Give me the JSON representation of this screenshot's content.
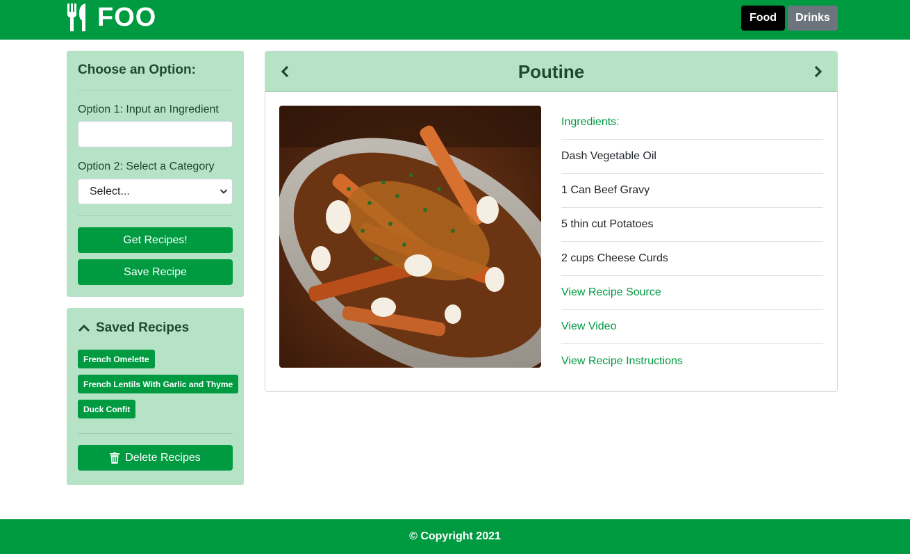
{
  "navbar": {
    "brand": "FOO",
    "tabs": [
      {
        "label": "Food",
        "active": true
      },
      {
        "label": "Drinks",
        "active": false
      }
    ]
  },
  "options": {
    "title": "Choose an Option:",
    "option1_label": "Option 1: Input an Ingredient",
    "option1_value": "",
    "option2_label": "Option 2: Select a Category",
    "select_value": "Select...",
    "get_recipes": "Get Recipes!",
    "save_recipe": "Save Recipe"
  },
  "saved": {
    "title": "Saved Recipes",
    "items": [
      "French Omelette",
      "French Lentils With Garlic and Thyme",
      "Duck Confit"
    ],
    "delete_label": "Delete Recipes"
  },
  "recipe": {
    "title": "Poutine",
    "ingredients_header": "Ingredients:",
    "ingredients": [
      "Dash Vegetable Oil",
      "1 Can Beef Gravy",
      "5 thin cut Potatoes",
      "2 cups Cheese Curds"
    ],
    "links": [
      "View Recipe Source",
      "View Video",
      "View Recipe Instructions"
    ]
  },
  "footer": {
    "text": "© Copyright 2021"
  },
  "colors": {
    "brand_green": "#009a41",
    "panel_green": "#b6e3c6",
    "text_dark_green": "#1d4a2c"
  }
}
